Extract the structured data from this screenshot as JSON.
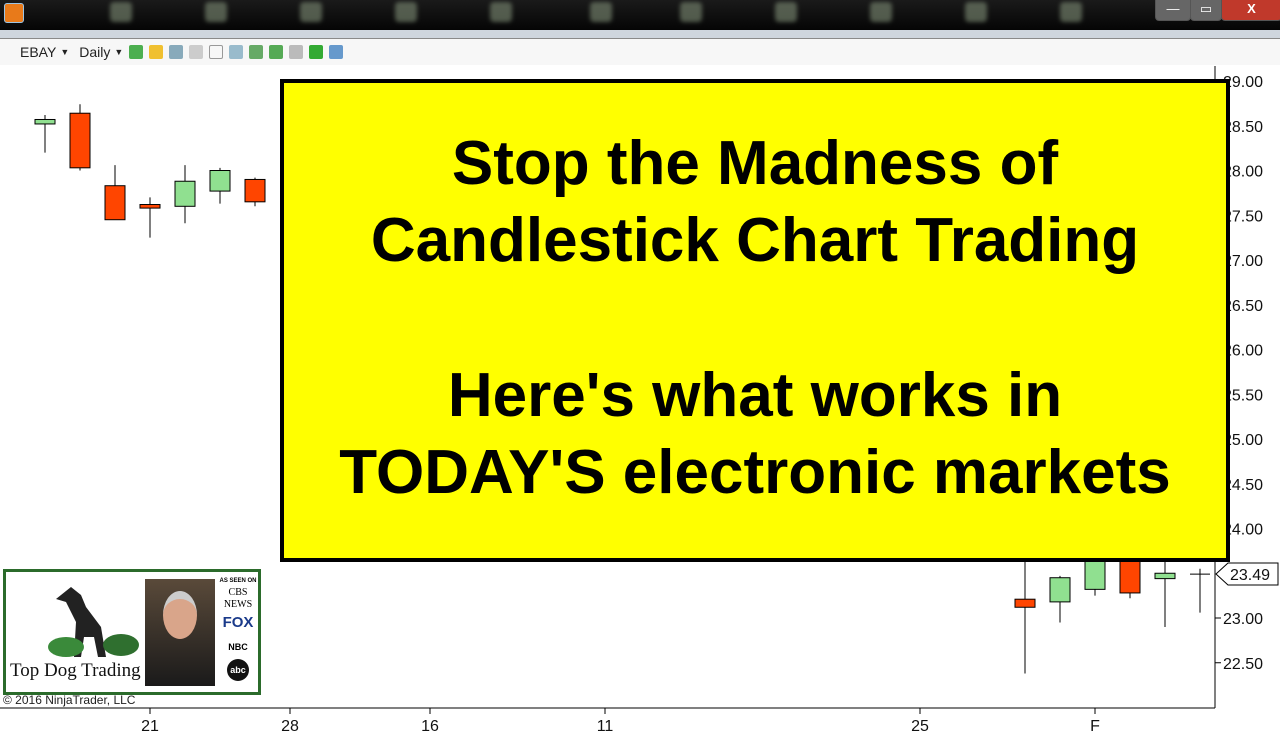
{
  "toolbar": {
    "instrument": "EBAY",
    "interval": "Daily"
  },
  "window_buttons": {
    "minimize": "—",
    "maximize": "▭",
    "close": "X"
  },
  "banner": {
    "line1": "Stop the Madness of",
    "line2": "Candlestick Chart Trading",
    "line3": "Here's what works in",
    "line4": "TODAY'S electronic markets"
  },
  "logo": {
    "brand": "Top Dog Trading",
    "as_seen_on": "AS SEEN ON",
    "networks": [
      "CBS NEWS",
      "FOX",
      "NBC",
      "abc"
    ]
  },
  "copyright": "© 2016 NinjaTrader, LLC",
  "colors": {
    "up": "#90e090",
    "down": "#ff4500",
    "banner": "#ffff00"
  },
  "chart_data": {
    "type": "candlestick",
    "instrument": "EBAY",
    "interval": "Daily",
    "ylim": [
      22.25,
      29.1
    ],
    "y_ticks": [
      "29.00",
      "28.50",
      "28.00",
      "27.50",
      "27.00",
      "26.50",
      "26.00",
      "25.50",
      "25.00",
      "24.50",
      "24.00",
      "23.00",
      "22.50"
    ],
    "x_ticks": [
      "21",
      "28",
      "16",
      "11",
      "25",
      "F"
    ],
    "last_price": "23.49",
    "candles_left": [
      {
        "o": 28.52,
        "h": 28.62,
        "l": 28.2,
        "c": 28.57
      },
      {
        "o": 28.64,
        "h": 28.74,
        "l": 28.0,
        "c": 28.03
      },
      {
        "o": 27.83,
        "h": 28.06,
        "l": 27.45,
        "c": 27.45
      },
      {
        "o": 27.62,
        "h": 27.7,
        "l": 27.25,
        "c": 27.58
      },
      {
        "o": 27.6,
        "h": 28.06,
        "l": 27.41,
        "c": 27.88
      },
      {
        "o": 27.77,
        "h": 28.03,
        "l": 27.63,
        "c": 28.0
      },
      {
        "o": 27.9,
        "h": 27.92,
        "l": 27.6,
        "c": 27.65
      }
    ],
    "candles_right": [
      {
        "o": 23.21,
        "h": 23.9,
        "l": 22.38,
        "c": 23.12
      },
      {
        "o": 23.18,
        "h": 23.47,
        "l": 22.95,
        "c": 23.45
      },
      {
        "o": 23.32,
        "h": 23.9,
        "l": 23.25,
        "c": 23.67
      },
      {
        "o": 23.7,
        "h": 23.9,
        "l": 23.22,
        "c": 23.28
      },
      {
        "o": 23.44,
        "h": 23.9,
        "l": 22.9,
        "c": 23.5
      },
      {
        "o": 23.49,
        "h": 23.55,
        "l": 23.06,
        "c": 23.49
      }
    ]
  }
}
